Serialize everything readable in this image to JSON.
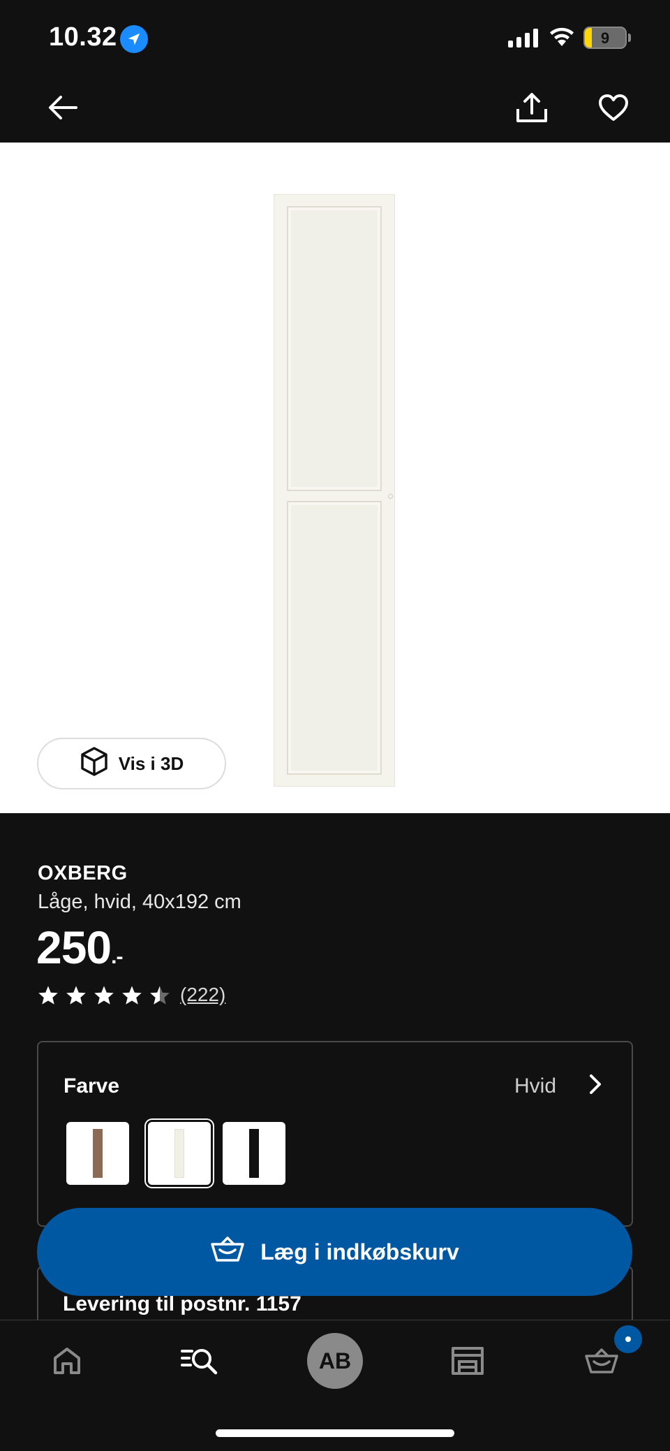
{
  "status_bar": {
    "time": "10.32",
    "battery_level": "9",
    "icons": [
      "location-arrow-icon",
      "cellular-signal-icon",
      "wifi-icon",
      "battery-icon"
    ],
    "battery_color": "#ffd60a"
  },
  "nav": {
    "icons": [
      "back-arrow-icon",
      "share-icon",
      "heart-icon"
    ]
  },
  "product": {
    "view_3d_label": "Vis i 3D",
    "brand": "OXBERG",
    "description": "Låge, hvid, 40x192 cm",
    "price": "250",
    "price_suffix": ".-",
    "rating_stars": 4.5,
    "rating_max": 5,
    "review_count": "(222)"
  },
  "color_selector": {
    "label": "Farve",
    "selected_value": "Hvid",
    "swatches": [
      {
        "name": "walnut",
        "color": "#8b6b55",
        "selected": false
      },
      {
        "name": "white",
        "color": "#f1f0e6",
        "selected": true
      },
      {
        "name": "black",
        "color": "#111111",
        "selected": false
      }
    ]
  },
  "cart": {
    "add_to_cart_label": "Læg i indkøbskurv",
    "button_color": "#0058a3"
  },
  "delivery": {
    "label": "Levering til postnr. 1157"
  },
  "tab_bar": {
    "avatar_initials": "AB",
    "icons": [
      "home-icon",
      "search-icon",
      "store-icon",
      "basket-icon"
    ],
    "cart_badge_color": "#0058a3"
  }
}
